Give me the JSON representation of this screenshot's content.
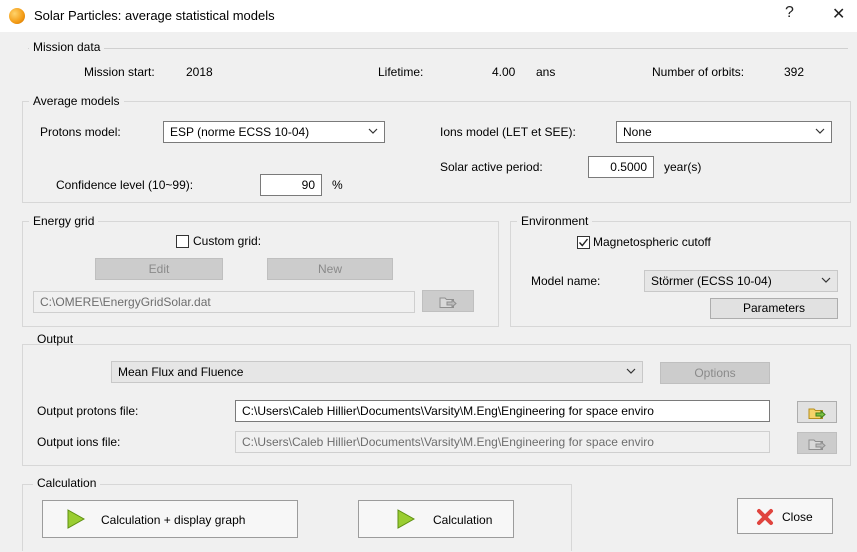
{
  "window": {
    "title": "Solar Particles: average statistical models",
    "help": "?",
    "close": "✕"
  },
  "mission": {
    "group_label": "Mission data",
    "start_label": "Mission start:",
    "start_value": "2018",
    "lifetime_label": "Lifetime:",
    "lifetime_value": "4.00",
    "lifetime_unit": "ans",
    "orbits_label": "Number of orbits:",
    "orbits_value": "392"
  },
  "average": {
    "group_label": "Average models",
    "protons_label": "Protons model:",
    "protons_value": "ESP (norme ECSS 10-04)",
    "ions_label": "Ions model (LET et SEE):",
    "ions_value": "None",
    "active_label": "Solar active period:",
    "active_value": "0.5000",
    "active_unit": "year(s)",
    "confidence_label": "Confidence level (10~99):",
    "confidence_value": "90",
    "confidence_unit": "%"
  },
  "energy": {
    "group_label": "Energy grid",
    "custom_label": "Custom grid:",
    "edit_label": "Edit",
    "new_label": "New",
    "file": "C:\\OMERE\\EnergyGridSolar.dat"
  },
  "environment": {
    "group_label": "Environment",
    "cutoff_label": "Magnetospheric cutoff",
    "model_label": "Model name:",
    "model_value": "Störmer (ECSS 10-04)",
    "parameters_label": "Parameters"
  },
  "output": {
    "group_label": "Output",
    "mode_value": "Mean Flux and Fluence",
    "options_label": "Options",
    "protons_file_label": "Output protons file:",
    "protons_file": "C:\\Users\\Caleb Hillier\\Documents\\Varsity\\M.Eng\\Engineering for space enviro",
    "ions_file_label": "Output ions file:",
    "ions_file": "C:\\Users\\Caleb Hillier\\Documents\\Varsity\\M.Eng\\Engineering for space enviro"
  },
  "calculation": {
    "group_label": "Calculation",
    "calc_graph_label": "Calculation + display graph",
    "calc_label": "Calculation",
    "close_label": "Close"
  },
  "colors": {
    "play_green": "#9acd32",
    "close_red": "#e0443e"
  }
}
